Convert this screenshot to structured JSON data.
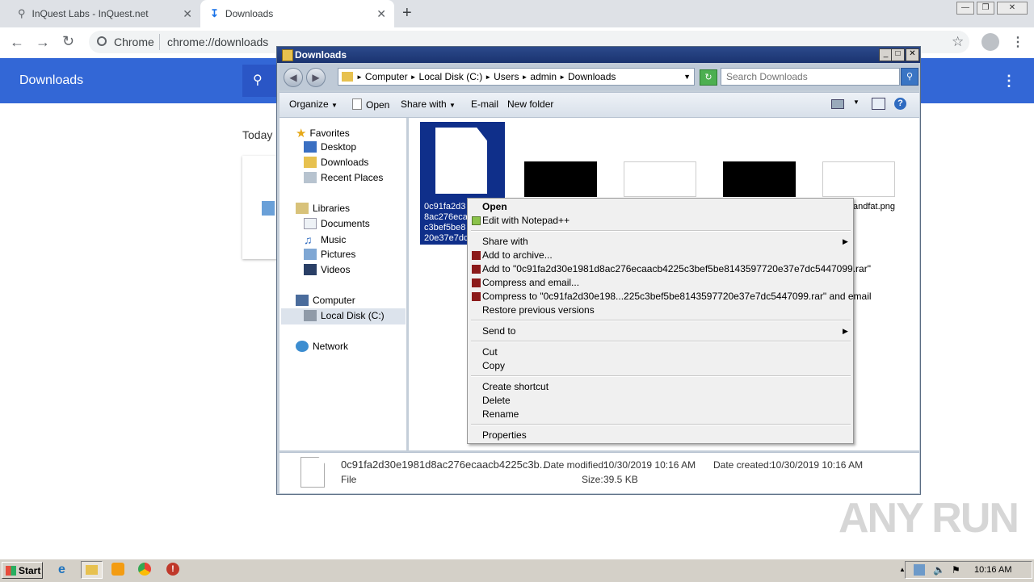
{
  "chrome": {
    "tabs": [
      {
        "title": "InQuest Labs - InQuest.net"
      },
      {
        "title": "Downloads"
      }
    ],
    "omnibox": {
      "scheme_label": "Chrome",
      "url": "chrome://downloads"
    }
  },
  "downloads_page": {
    "title": "Downloads",
    "section_today": "Today"
  },
  "explorer": {
    "window_title": "Downloads",
    "breadcrumb": [
      "Computer",
      "Local Disk (C:)",
      "Users",
      "admin",
      "Downloads"
    ],
    "search_placeholder": "Search Downloads",
    "commands": {
      "organize": "Organize",
      "open": "Open",
      "share_with": "Share with",
      "email": "E-mail",
      "new_folder": "New folder"
    },
    "nav": {
      "favorites": "Favorites",
      "desktop": "Desktop",
      "downloads": "Downloads",
      "recent_places": "Recent Places",
      "libraries": "Libraries",
      "documents": "Documents",
      "music": "Music",
      "pictures": "Pictures",
      "videos": "Videos",
      "computer": "Computer",
      "local_disk": "Local Disk (C:)",
      "network": "Network"
    },
    "files": {
      "selected_name_visible": "0c91fa2d3\n8ac276eca\nc3bef5be8\n20e37e7dc",
      "png_suffix": "andfat.png"
    },
    "details": {
      "name": "0c91fa2d30e1981d8ac276ecaacb4225c3b...",
      "type": "File",
      "date_modified_label": "Date modified:",
      "date_modified": "10/30/2019 10:16 AM",
      "date_created_label": "Date created:",
      "date_created": "10/30/2019 10:16 AM",
      "size_label": "Size:",
      "size": "39.5 KB"
    }
  },
  "context_menu": {
    "open": "Open",
    "edit_notepad": "Edit with Notepad++",
    "share_with": "Share with",
    "add_archive": "Add to archive...",
    "add_to_rar": "Add to \"0c91fa2d30e1981d8ac276ecaacb4225c3bef5be8143597720e37e7dc5447099.rar\"",
    "compress_email": "Compress and email...",
    "compress_to_email": "Compress to \"0c91fa2d30e198...225c3bef5be8143597720e37e7dc5447099.rar\" and email",
    "restore_versions": "Restore previous versions",
    "send_to": "Send to",
    "cut": "Cut",
    "copy": "Copy",
    "create_shortcut": "Create shortcut",
    "delete": "Delete",
    "rename": "Rename",
    "properties": "Properties"
  },
  "taskbar": {
    "start": "Start",
    "clock": "10:16 AM"
  },
  "watermark": "ANY RUN"
}
